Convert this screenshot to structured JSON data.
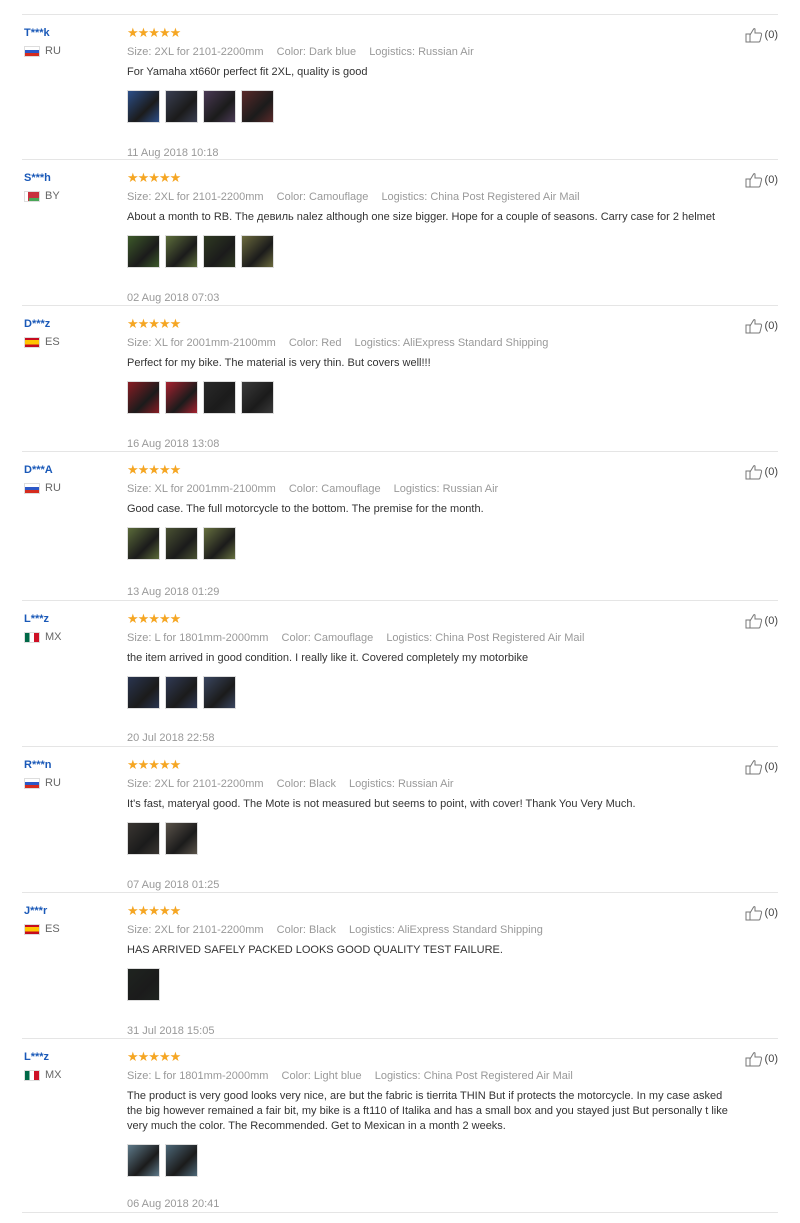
{
  "reviews": [
    {
      "buyer": "T***k",
      "country": "RU",
      "flag": "ru",
      "stars": "★★★★★",
      "size_label": "Size:",
      "size": "2XL for 2101-2200mm",
      "color_label": "Color:",
      "color": "Dark blue",
      "logistics_label": "Logistics:",
      "logistics": "Russian Air",
      "text": "For Yamaha xt660r perfect fit 2XL, quality is good",
      "photos": [
        "#2c4f8a",
        "#3a3f52",
        "#4a3a55",
        "#5a2a2a"
      ],
      "date": "11 Aug 2018 10:18",
      "useful": "(0)"
    },
    {
      "buyer": "S***h",
      "country": "BY",
      "flag": "by",
      "stars": "★★★★★",
      "size_label": "Size:",
      "size": "2XL for 2101-2200mm",
      "color_label": "Color:",
      "color": "Camouflage",
      "logistics_label": "Logistics:",
      "logistics": "China Post Registered Air Mail",
      "text": "About a month to RB. The девиль nalez although one size bigger. Hope for a couple of seasons. Carry case for 2 helmet",
      "photos": [
        "#3d5a2a",
        "#5d6e3b",
        "#2f3a22",
        "#6b6a3d"
      ],
      "date": "02 Aug 2018 07:03",
      "useful": "(0)"
    },
    {
      "buyer": "D***z",
      "country": "ES",
      "flag": "es",
      "stars": "★★★★★",
      "size_label": "Size:",
      "size": "XL for 2001mm-2100mm",
      "color_label": "Color:",
      "color": "Red",
      "logistics_label": "Logistics:",
      "logistics": "AliExpress Standard Shipping",
      "text": "Perfect for my bike. The material is very thin. But covers well!!!",
      "photos": [
        "#8a1c24",
        "#a82230",
        "#2a2a2a",
        "#3a3a3a"
      ],
      "date": "16 Aug 2018 13:08",
      "useful": "(0)"
    },
    {
      "buyer": "D***A",
      "country": "RU",
      "flag": "ru",
      "stars": "★★★★★",
      "size_label": "Size:",
      "size": "XL for 2001mm-2100mm",
      "color_label": "Color:",
      "color": "Camouflage",
      "logistics_label": "Logistics:",
      "logistics": "Russian Air",
      "text": "Good case. The full motorcycle to the bottom. The premise for the month.",
      "photos": [
        "#5b6b3a",
        "#4a5233",
        "#66703f"
      ],
      "date": "13 Aug 2018 01:29",
      "useful": "(0)"
    },
    {
      "buyer": "L***z",
      "country": "MX",
      "flag": "mx",
      "stars": "★★★★★",
      "size_label": "Size:",
      "size": "L for 1801mm-2000mm",
      "color_label": "Color:",
      "color": "Camouflage",
      "logistics_label": "Logistics:",
      "logistics": "China Post Registered Air Mail",
      "text": "the item arrived in good condition. I really like it. Covered completely my motorbike",
      "photos": [
        "#2a3550",
        "#303a55",
        "#3a4660"
      ],
      "date": "20 Jul 2018 22:58",
      "useful": "(0)"
    },
    {
      "buyer": "R***n",
      "country": "RU",
      "flag": "ru",
      "stars": "★★★★★",
      "size_label": "Size:",
      "size": "2XL for 2101-2200mm",
      "color_label": "Color:",
      "color": "Black",
      "logistics_label": "Logistics:",
      "logistics": "Russian Air",
      "text": "It's fast, materyal good. The Mote is not measured but seems to point, with cover! Thank You Very Much.",
      "photos": [
        "#3a3632",
        "#5a534a"
      ],
      "date": "07 Aug 2018 01:25",
      "useful": "(0)"
    },
    {
      "buyer": "J***r",
      "country": "ES",
      "flag": "es",
      "stars": "★★★★★",
      "size_label": "Size:",
      "size": "2XL for 2101-2200mm",
      "color_label": "Color:",
      "color": "Black",
      "logistics_label": "Logistics:",
      "logistics": "AliExpress Standard Shipping",
      "text": "HAS ARRIVED SAFELY PACKED LOOKS GOOD QUALITY TEST FAILURE.",
      "photos": [
        "#1f2420"
      ],
      "date": "31 Jul 2018 15:05",
      "useful": "(0)"
    },
    {
      "buyer": "L***z",
      "country": "MX",
      "flag": "mx",
      "stars": "★★★★★",
      "size_label": "Size:",
      "size": "L for 1801mm-2000mm",
      "color_label": "Color:",
      "color": "Light blue",
      "logistics_label": "Logistics:",
      "logistics": "China Post Registered Air Mail",
      "text": "The product is very good looks very nice, are but the fabric is tierrita THIN But if protects the motorcycle. In my case asked the big however remained a fair bit, my bike is a ft110 of Italika and has a small box and you stayed just But personally t like very much the color. The Recommended. Get to Mexican in a month 2 weeks.",
      "photos": [
        "#5e7a8a",
        "#4d6878"
      ],
      "date": "06 Aug 2018 20:41",
      "useful": "(0)"
    }
  ]
}
